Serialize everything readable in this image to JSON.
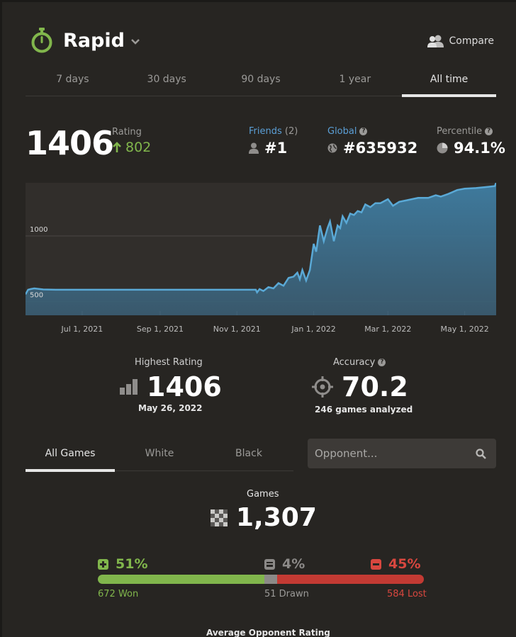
{
  "header": {
    "title": "Rapid",
    "compare_label": "Compare"
  },
  "period_tabs": [
    {
      "label": "7 days",
      "active": false
    },
    {
      "label": "30 days",
      "active": false
    },
    {
      "label": "90 days",
      "active": false
    },
    {
      "label": "1 year",
      "active": false
    },
    {
      "label": "All time",
      "active": true
    }
  ],
  "summary": {
    "rating": "1406",
    "rating_label": "Rating",
    "rating_change": "802",
    "friends_label": "Friends",
    "friends_count": "(2)",
    "friends_rank": "#1",
    "global_label": "Global",
    "global_rank": "#635932",
    "percentile_label": "Percentile",
    "percentile_value": "94.1%"
  },
  "chart_data": {
    "type": "area",
    "title": "",
    "xlabel": "",
    "ylabel": "",
    "y_tick_labels": [
      "1000",
      "500"
    ],
    "y_ticks": [
      1000,
      500
    ],
    "x_tick_labels": [
      "Jul 1, 2021",
      "Sep 1, 2021",
      "Nov 1, 2021",
      "Jan 1, 2022",
      "Mar 1, 2022",
      "May 1, 2022"
    ],
    "x_ticks": [
      "2021-07-01",
      "2021-09-01",
      "2021-11-01",
      "2022-01-01",
      "2022-03-01",
      "2022-05-01"
    ],
    "xlim": [
      "2021-05-17",
      "2022-05-26"
    ],
    "ylim": [
      395,
      1405
    ],
    "grid": true,
    "color": "#5aa9d6",
    "x": [
      "2021-05-17",
      "2021-05-19",
      "2021-05-21",
      "2021-05-24",
      "2021-05-31",
      "2021-06-10",
      "2021-07-01",
      "2021-08-01",
      "2021-09-01",
      "2021-10-01",
      "2021-11-01",
      "2021-11-16",
      "2021-11-17",
      "2021-11-19",
      "2021-11-22",
      "2021-11-26",
      "2021-11-30",
      "2021-12-04",
      "2021-12-08",
      "2021-12-12",
      "2021-12-16",
      "2021-12-19",
      "2021-12-21",
      "2021-12-23",
      "2021-12-26",
      "2021-12-29",
      "2022-01-01",
      "2022-01-03",
      "2022-01-06",
      "2022-01-09",
      "2022-01-12",
      "2022-01-14",
      "2022-01-17",
      "2022-01-20",
      "2022-01-22",
      "2022-01-24",
      "2022-01-27",
      "2022-01-30",
      "2022-02-02",
      "2022-02-05",
      "2022-02-08",
      "2022-02-11",
      "2022-02-15",
      "2022-02-19",
      "2022-02-23",
      "2022-03-01",
      "2022-03-05",
      "2022-03-10",
      "2022-03-15",
      "2022-03-20",
      "2022-03-25",
      "2022-03-29",
      "2022-04-02",
      "2022-04-08",
      "2022-04-12",
      "2022-04-18",
      "2022-04-25",
      "2022-05-01",
      "2022-05-10",
      "2022-05-20",
      "2022-05-25",
      "2022-05-26"
    ],
    "y": [
      555,
      590,
      595,
      600,
      592,
      590,
      590,
      590,
      590,
      590,
      590,
      590,
      570,
      595,
      580,
      610,
      600,
      640,
      620,
      680,
      690,
      720,
      670,
      740,
      660,
      740,
      940,
      880,
      1080,
      960,
      1060,
      1110,
      960,
      1080,
      1060,
      1150,
      1100,
      1170,
      1160,
      1190,
      1180,
      1240,
      1220,
      1250,
      1250,
      1280,
      1230,
      1260,
      1270,
      1280,
      1290,
      1290,
      1290,
      1310,
      1300,
      1320,
      1350,
      1360,
      1365,
      1375,
      1380,
      1406
    ]
  },
  "highest": {
    "label": "Highest Rating",
    "value": "1406",
    "date": "May 26, 2022"
  },
  "accuracy": {
    "label": "Accuracy",
    "value": "70.2",
    "sub": "246 games analyzed"
  },
  "game_tabs": [
    {
      "label": "All Games",
      "active": true
    },
    {
      "label": "White",
      "active": false
    },
    {
      "label": "Black",
      "active": false
    }
  ],
  "opponent_search": {
    "placeholder": "Opponent...",
    "value": ""
  },
  "games": {
    "label": "Games",
    "total": "1,307",
    "won_pct": "51%",
    "drawn_pct": "4%",
    "lost_pct": "45%",
    "won_fraction": 0.51,
    "drawn_fraction": 0.04,
    "lost_fraction": 0.45,
    "won_label": "672 Won",
    "drawn_label": "51 Drawn",
    "lost_label": "584 Lost",
    "won_color": "#81b64c",
    "drawn_color": "#8c8a88",
    "lost_color": "#c33a33"
  },
  "avg_opponent_label": "Average Opponent Rating",
  "colors": {
    "accent_green": "#81b64c",
    "friends_blue": "#5b9fd6"
  }
}
